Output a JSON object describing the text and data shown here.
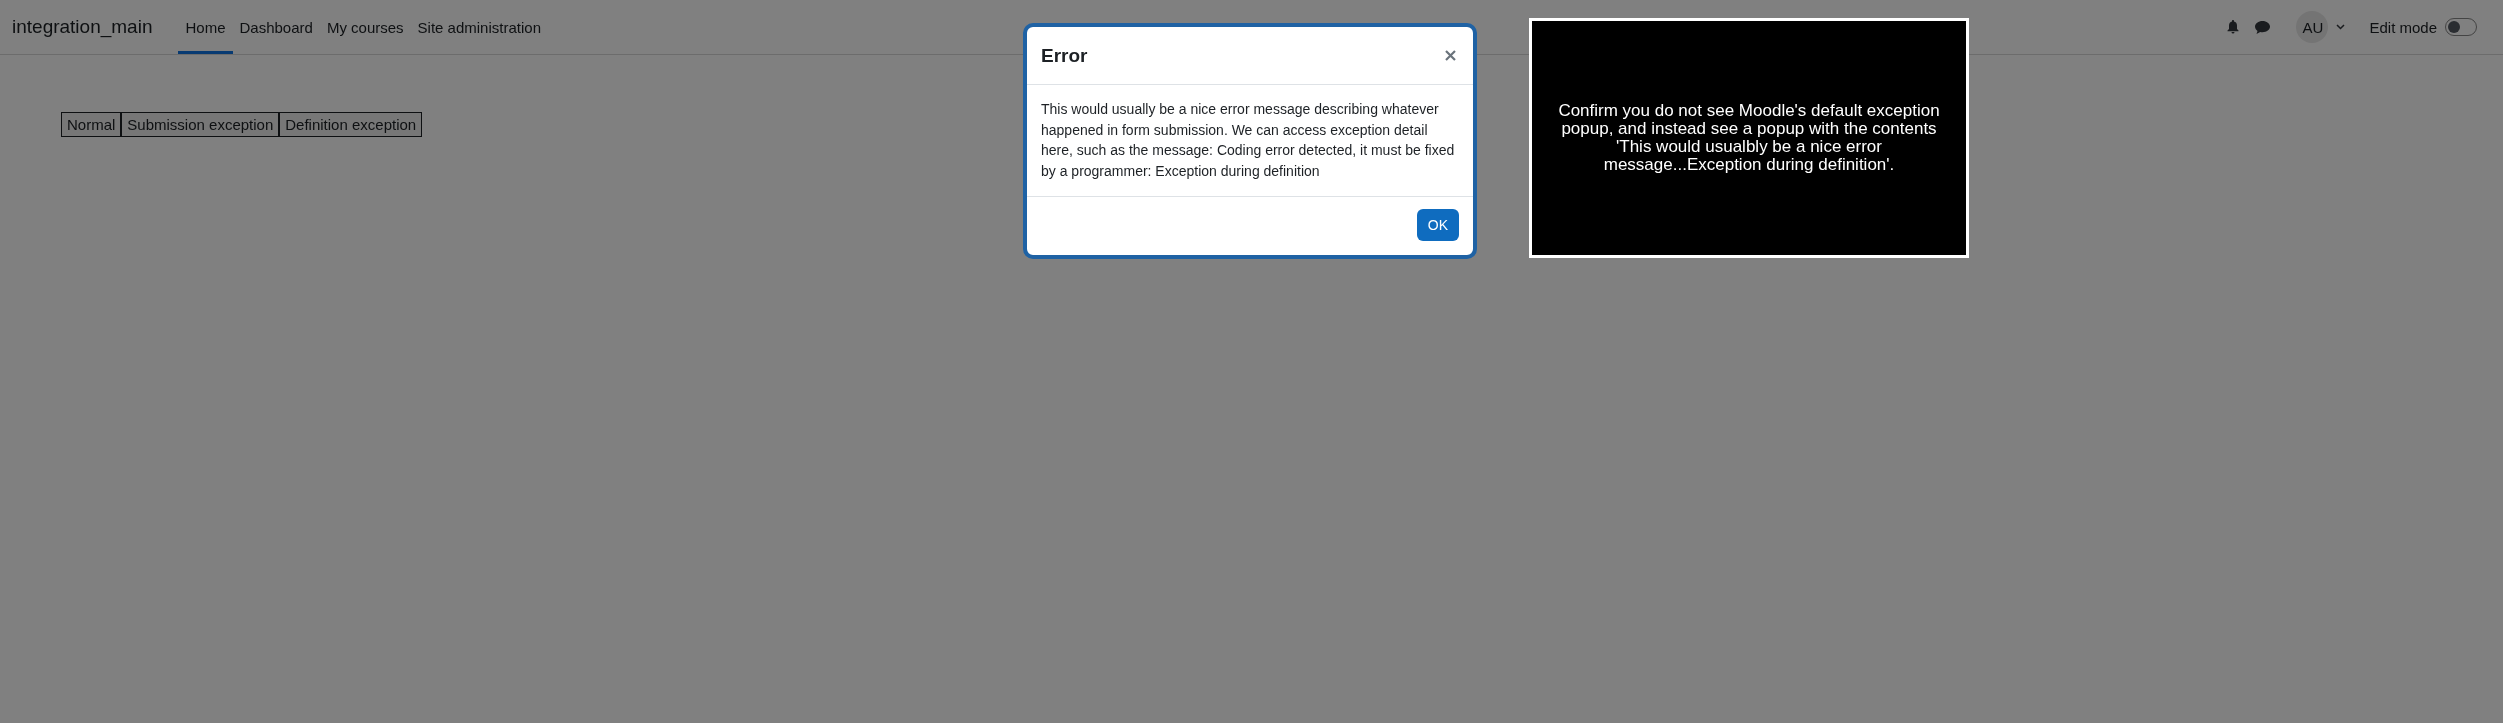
{
  "navbar": {
    "site_name": "integration_main",
    "nav_items": [
      {
        "label": "Home",
        "selected": true
      },
      {
        "label": "Dashboard",
        "selected": false
      },
      {
        "label": "My courses",
        "selected": false
      },
      {
        "label": "Site administration",
        "selected": false
      }
    ],
    "user_initials": "AU",
    "edit_mode": {
      "label": "Edit mode",
      "on": false
    }
  },
  "test_buttons": [
    "Normal",
    "Submission exception",
    "Definition exception"
  ],
  "modal": {
    "title": "Error",
    "body": "This would usually be a nice error message describing whatever happened in form submission. We can access exception detail here, such as the message: Coding error detected, it must be fixed by a programmer: Exception during definition",
    "button": "OK"
  },
  "instruction_panel": {
    "text": "Confirm you do not see Moodle's default exception popup, and instead see a popup with the contents 'This would usualbly be a nice error message...Exception during definition'."
  }
}
